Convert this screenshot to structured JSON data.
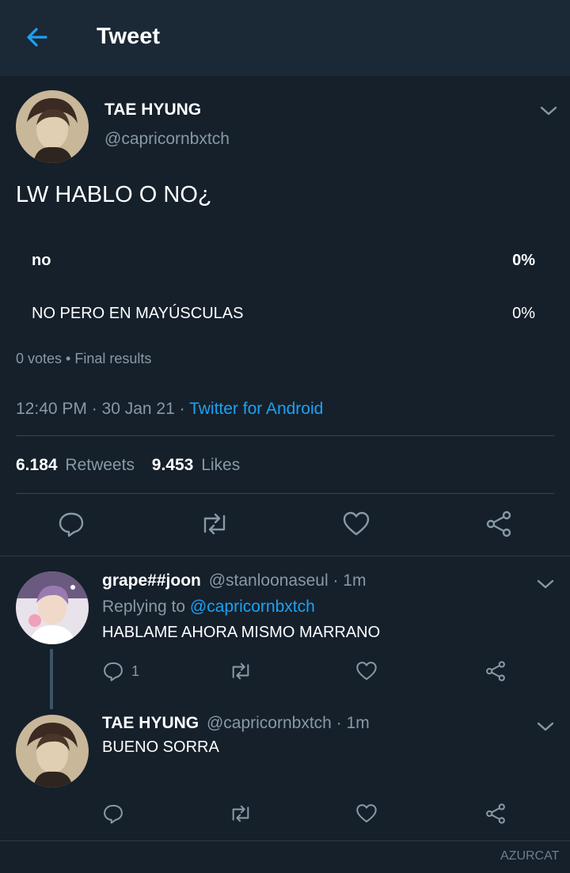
{
  "header": {
    "title": "Tweet",
    "back_icon": "arrow-left-icon"
  },
  "tweet": {
    "author_name": "TAE HYUNG",
    "author_handle": "@capricornbxtch",
    "text": "LW HABLO O NO¿",
    "poll": {
      "options": [
        {
          "label": "no",
          "percent": "0%",
          "bold": true
        },
        {
          "label": "NO PERO EN MAYÚSCULAS",
          "percent": "0%",
          "bold": false
        }
      ],
      "summary": "0 votes • Final results"
    },
    "time": "12:40 PM · 30 Jan 21 · ",
    "source": "Twitter for Android",
    "retweets_count": "6.184",
    "retweets_label": "Retweets",
    "likes_count": "9.453",
    "likes_label": "Likes"
  },
  "replies": [
    {
      "name": "grape##joon",
      "handle": "@stanloonaseul · 1m",
      "replying_prefix": "Replying to ",
      "replying_to": "@capricornbxtch",
      "text": "HABLAME AHORA MISMO MARRANO",
      "reply_count": "1"
    },
    {
      "name": "TAE HYUNG",
      "handle": "@capricornbxtch · 1m",
      "text": "BUENO SORRA",
      "reply_count": ""
    }
  ],
  "watermark": "AZURCAT",
  "colors": {
    "background": "#15202b",
    "header": "#1b2836",
    "accent": "#1da1f2",
    "muted": "#8899a6"
  }
}
